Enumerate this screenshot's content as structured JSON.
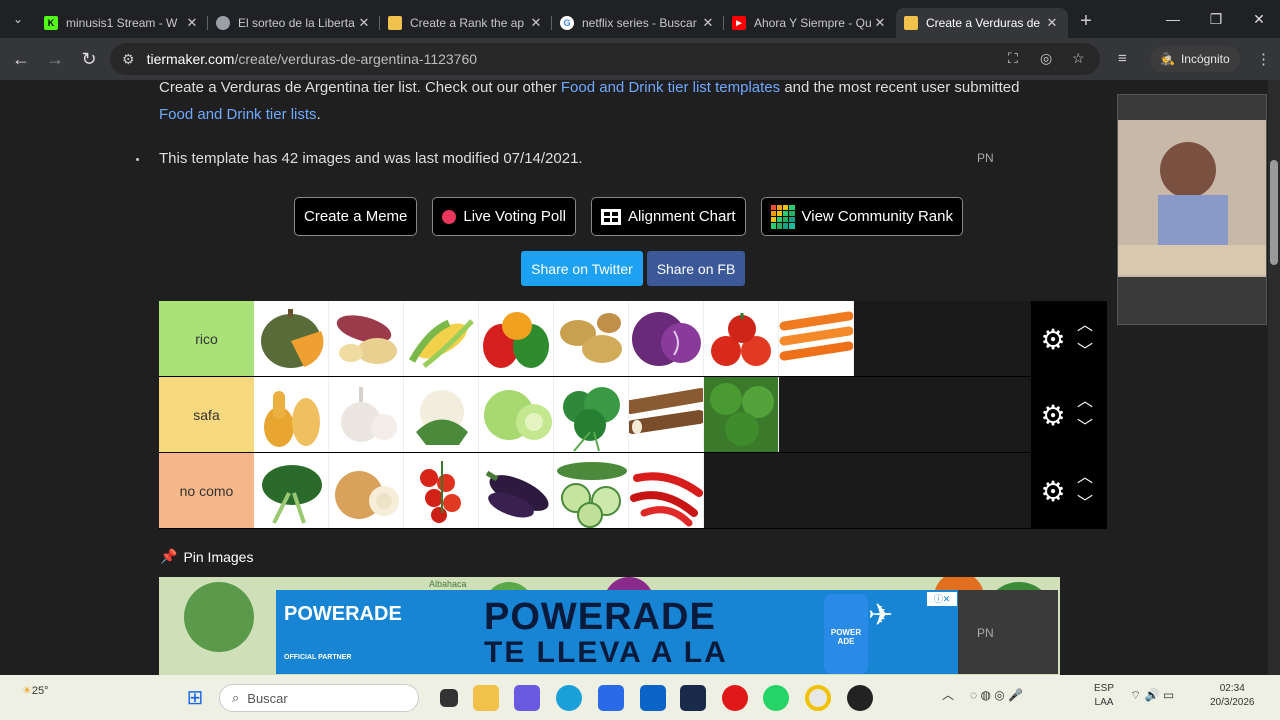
{
  "browser": {
    "tabs": [
      {
        "title": "minusis1 Stream - W",
        "fav_color": "#53fc18",
        "fav_char": "K"
      },
      {
        "title": "El sorteo de la Liberta",
        "fav_color": "#9aa0a6",
        "fav_char": ""
      },
      {
        "title": "Create a Rank the ap",
        "fav_color": "#f0c24b",
        "fav_char": ""
      },
      {
        "title": "netflix series - Buscar",
        "fav_color": "#ffffff",
        "fav_char": "G"
      },
      {
        "title": "Ahora Y Siempre - Qu",
        "fav_color": "#ff0000",
        "fav_char": "▶"
      },
      {
        "title": "Create a Verduras de",
        "fav_color": "#f0c24b",
        "fav_char": ""
      }
    ],
    "new_tab": "+",
    "url_domain": "tiermaker.com",
    "url_path": "/create/verduras-de-argentina-1123760",
    "incognito_label": "Incógnito"
  },
  "page": {
    "desc_text_1": "Create a Verduras de Argentina tier list. Check out our other ",
    "desc_link_1": "Food and Drink tier list templates",
    "desc_text_2": " and the most recent user submitted ",
    "desc_link_2": "Food and Drink tier lists",
    "desc_text_3": ".",
    "meta": "This template has 42 images and was last modified 07/14/2021.",
    "pn": "PN",
    "buttons": {
      "meme": "Create a Meme",
      "poll": "Live Voting Poll",
      "alignment": "Alignment Chart",
      "community": "View Community Rank"
    },
    "share_twitter": "Share on Twitter",
    "share_fb": "Share on FB",
    "tiers": [
      {
        "label": "rico",
        "color": "#a8e278",
        "items": [
          "squash",
          "sweet-potato",
          "corn",
          "peppers",
          "potatoes",
          "red-cabbage",
          "tomatoes",
          "carrots"
        ]
      },
      {
        "label": "safa",
        "color": "#f6d97e",
        "items": [
          "butternut",
          "garlic",
          "cauliflower",
          "lettuce",
          "parsley",
          "cassava",
          "limes"
        ]
      },
      {
        "label": "no como",
        "color": "#f6b88a",
        "items": [
          "chard",
          "onion",
          "cherry-tomatoes",
          "eggplant",
          "cucumber",
          "chili"
        ]
      }
    ],
    "pin_images": "Pin Images",
    "pin_strip_label": "Albahaca",
    "ad": {
      "brand": "POWERADE",
      "line1": "POWERADE",
      "line2": "TE LLEVA A LA",
      "partner": "OFFICIAL PARTNER",
      "bottle": "POWER ADE"
    }
  },
  "taskbar": {
    "weather": "25°",
    "search_placeholder": "Buscar",
    "lang1": "ESP",
    "lang2": "LAA",
    "time": "02:34",
    "date": "20/3/2026"
  }
}
